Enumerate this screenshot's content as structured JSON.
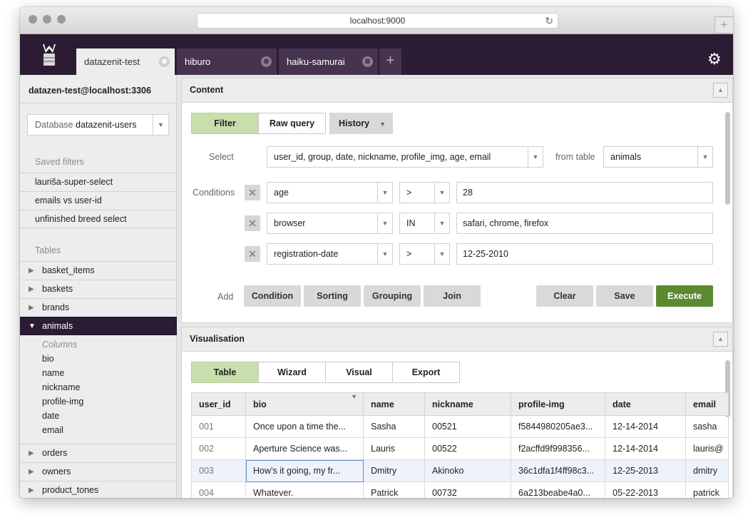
{
  "browser": {
    "url": "localhost:9000",
    "new_tab_symbol": "+"
  },
  "tabs": [
    {
      "label": "datazenit-test",
      "active": true
    },
    {
      "label": "hiburo",
      "active": false
    },
    {
      "label": "haiku-samurai",
      "active": false
    }
  ],
  "tab_close_symbol": "⊗",
  "add_tab_symbol": "+",
  "sidebar": {
    "connection": "datazen-test@localhost:3306",
    "database_label": "Database",
    "database_value": "datazenit-users",
    "saved_filters_title": "Saved filters",
    "saved_filters": [
      "lauriša-super-select",
      "emails vs user-id",
      "unfinished breed select"
    ],
    "tables_title": "Tables",
    "tables_before": [
      "basket_items",
      "baskets",
      "brands"
    ],
    "active_table": "animals",
    "columns_label": "Columns",
    "columns": [
      "bio",
      "name",
      "nickname",
      "profile-img",
      "date",
      "email"
    ],
    "tables_after": [
      "orders",
      "owners",
      "product_tones"
    ]
  },
  "content": {
    "title": "Content",
    "modes": {
      "filter": "Filter",
      "raw": "Raw query",
      "history": "History"
    },
    "select_label": "Select",
    "select_value": "user_id, group, date, nickname, profile_img, age, email",
    "from_label": "from table",
    "from_value": "animals",
    "conditions_label": "Conditions",
    "conditions": [
      {
        "field": "age",
        "op": ">",
        "value": "28"
      },
      {
        "field": "browser",
        "op": "IN",
        "value": "safari, chrome, firefox"
      },
      {
        "field": "registration-date",
        "op": ">",
        "value": "12-25-2010"
      }
    ],
    "add_label": "Add",
    "add_buttons": [
      "Condition",
      "Sorting",
      "Grouping",
      "Join"
    ],
    "actions": {
      "clear": "Clear",
      "save": "Save",
      "execute": "Execute"
    }
  },
  "visualisation": {
    "title": "Visualisation",
    "tabs": [
      "Table",
      "Wizard",
      "Visual",
      "Export"
    ],
    "columns": [
      "user_id",
      "bio",
      "name",
      "nickname",
      "profile-img",
      "date",
      "email"
    ],
    "rows": [
      [
        "001",
        "Once upon a time the...",
        "Sasha",
        "00521",
        "f5844980205ae3...",
        "12-14-2014",
        "sasha"
      ],
      [
        "002",
        "Aperture Science was...",
        "Lauris",
        "00522",
        "f2acffd9f998356...",
        "12-14-2014",
        "lauris@"
      ],
      [
        "003",
        "How’s it going, my fr...",
        "Dmitry",
        "Akinoko",
        "36c1dfa1f4ff98c3...",
        "12-25-2013",
        "dmitry"
      ],
      [
        "004",
        "Whatever.",
        "Patrick",
        "00732",
        "6a213beabe4a0...",
        "05-22-2013",
        "patrick"
      ]
    ]
  },
  "colors": {
    "accent_dark": "#2b1b33",
    "filter_active": "#c8dfad",
    "execute": "#5c8a31"
  }
}
